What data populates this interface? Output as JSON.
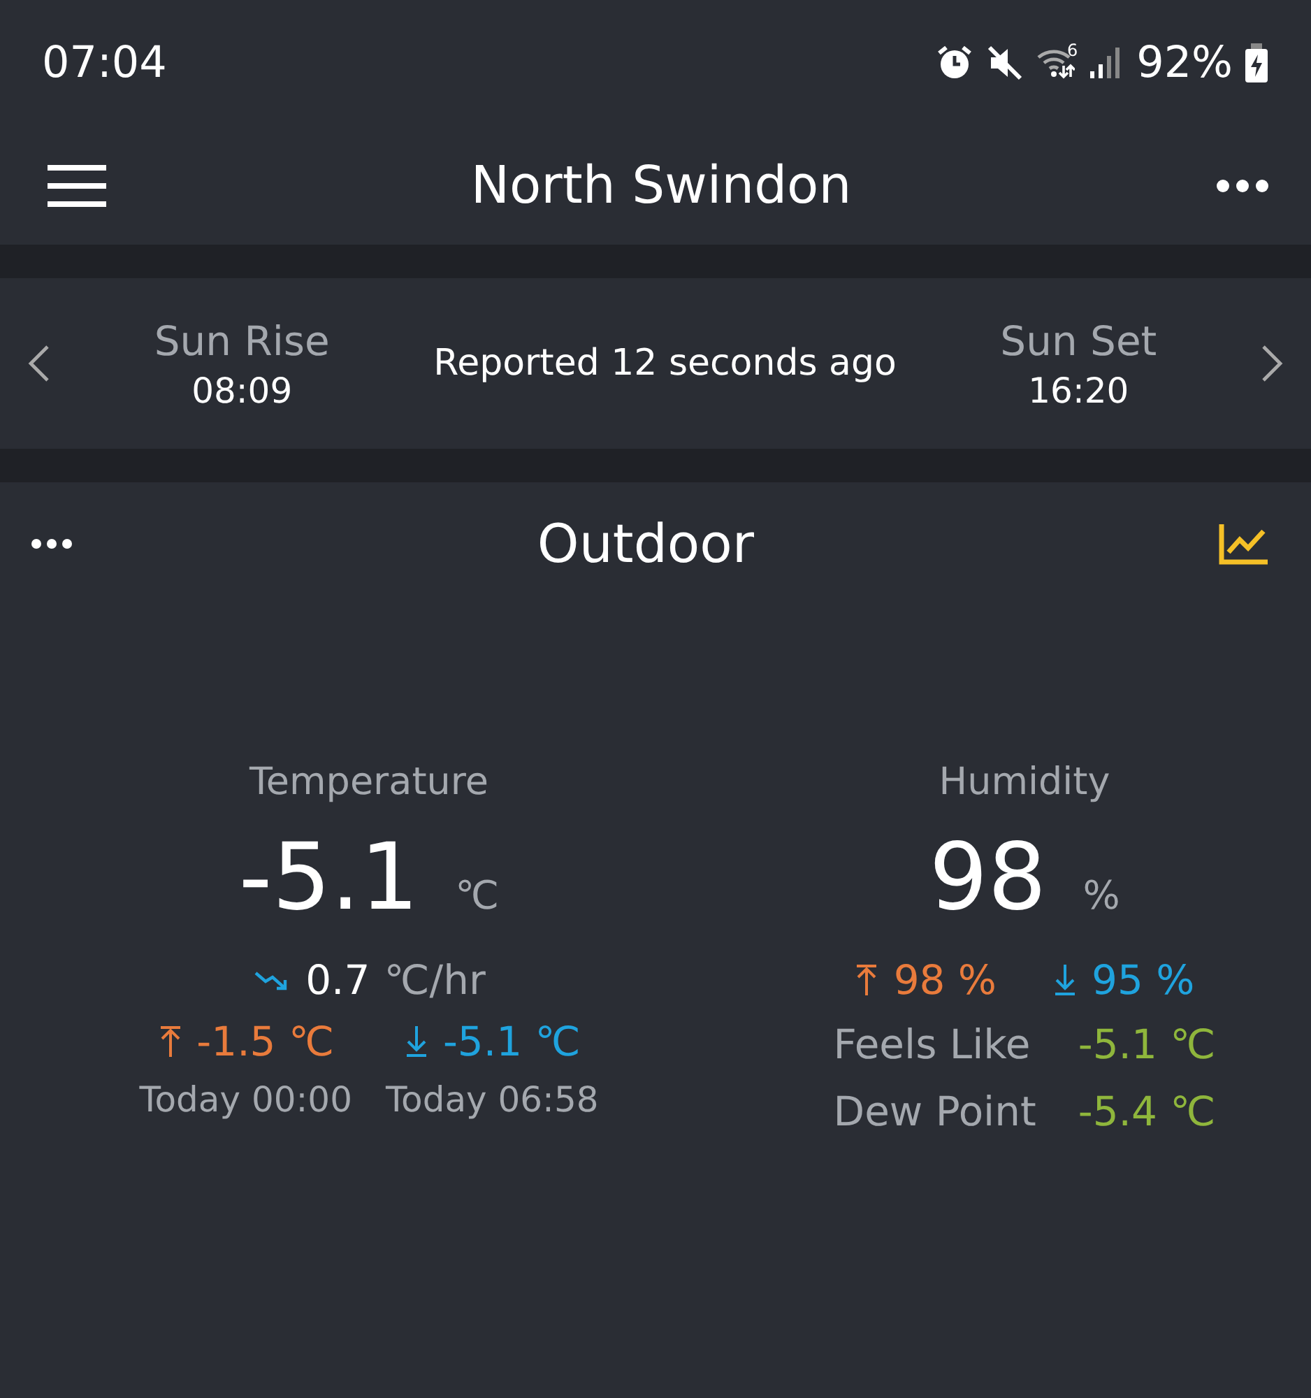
{
  "status_bar": {
    "time": "07:04",
    "wifi_badge": "6",
    "battery": "92%"
  },
  "header": {
    "title": "North Swindon"
  },
  "sun": {
    "rise_label": "Sun Rise",
    "rise_time": "08:09",
    "report": "Reported 12 seconds ago",
    "set_label": "Sun Set",
    "set_time": "16:20"
  },
  "panel": {
    "title": "Outdoor",
    "temperature": {
      "label": "Temperature",
      "value": "-5.1",
      "unit": "℃",
      "trend": "0.7",
      "trend_unit": "℃/hr",
      "extremes": [
        {
          "kind": "high",
          "value": "-1.5 ℃",
          "time": "Today 00:00"
        },
        {
          "kind": "low",
          "value": "-5.1 ℃",
          "time": "Today 06:58"
        }
      ]
    },
    "humidity": {
      "label": "Humidity",
      "value": "98",
      "unit": "%",
      "extremes": [
        {
          "kind": "high",
          "value": "98 %"
        },
        {
          "kind": "low",
          "value": "95 %"
        }
      ],
      "details": [
        {
          "label": "Feels Like",
          "value": "-5.1 ℃"
        },
        {
          "label": "Dew Point",
          "value": "-5.4 ℃"
        }
      ]
    }
  }
}
